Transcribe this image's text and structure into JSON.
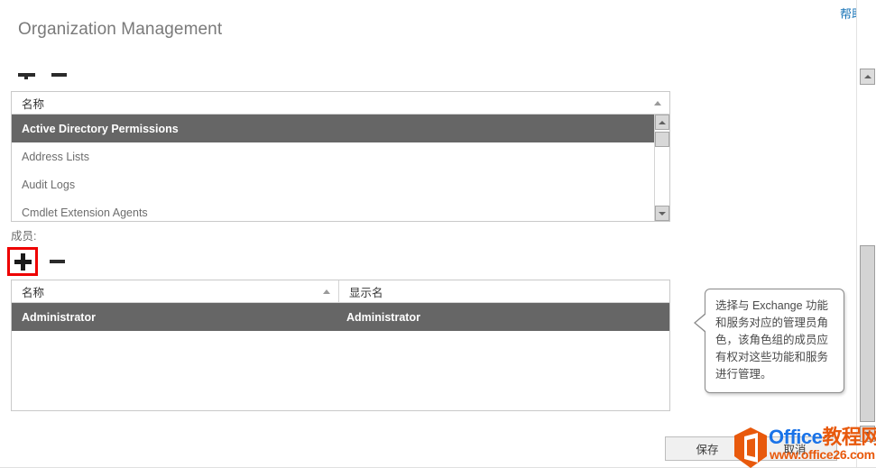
{
  "header": {
    "help_label": "帮助",
    "page_title": "Organization Management"
  },
  "roles_section": {
    "toolbar": {
      "add_label": "+",
      "remove_label": "−"
    },
    "columns": [
      "名称"
    ],
    "sort": "asc",
    "rows": [
      {
        "name": "Active Directory Permissions",
        "selected": true
      },
      {
        "name": "Address Lists",
        "selected": false
      },
      {
        "name": "Audit Logs",
        "selected": false
      },
      {
        "name": "Cmdlet Extension Agents",
        "selected": false
      }
    ]
  },
  "members_section": {
    "label": "成员:",
    "toolbar": {
      "add_label": "+",
      "remove_label": "−"
    },
    "columns": [
      "名称",
      "显示名"
    ],
    "sort": "asc",
    "rows": [
      {
        "name": "Administrator",
        "display_name": "Administrator",
        "selected": true
      }
    ]
  },
  "callout": {
    "text": "选择与 Exchange 功能和服务对应的管理员角色，该角色组的成员应有权对这些功能和服务进行管理。"
  },
  "footer": {
    "save_label": "保存",
    "cancel_label": "取消"
  },
  "watermark": {
    "brand_office": "Office",
    "brand_cn": "教程网",
    "url": "www.office26.com"
  },
  "colors": {
    "selection": "#666666",
    "link": "#1572b6",
    "highlight_box": "#ee0000",
    "title": "#7a7a7a",
    "watermark_blue": "#1a73e8",
    "watermark_orange": "#e8590c"
  }
}
